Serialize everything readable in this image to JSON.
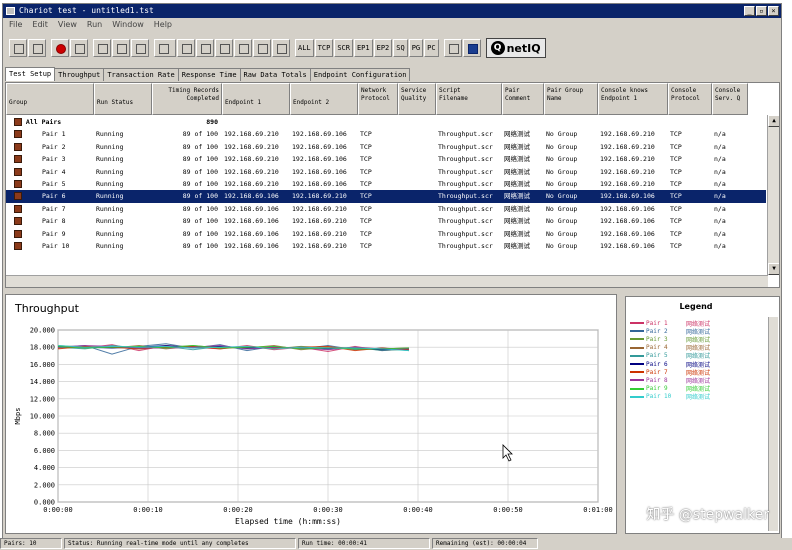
{
  "window": {
    "title": "Chariot test - untitled1.tst",
    "controls": [
      "_",
      "▫",
      "×"
    ]
  },
  "menu": [
    "File",
    "Edit",
    "View",
    "Run",
    "Window",
    "Help"
  ],
  "toolbar": {
    "text_buttons": [
      "ALL",
      "TCP",
      "SCR",
      "EP1",
      "EP2",
      "SQ",
      "PG",
      "PC"
    ],
    "logo": "netIQ"
  },
  "tabs": [
    "Test Setup",
    "Throughput",
    "Transaction Rate",
    "Response Time",
    "Raw Data Totals",
    "Endpoint Configuration"
  ],
  "active_tab": "Test Setup",
  "grid": {
    "headers": [
      "Group",
      "Run Status",
      "Timing Records\nCompleted",
      "Endpoint 1",
      "Endpoint 2",
      "Network\nProtocol",
      "Service\nQuality",
      "Script\nFilename",
      "Pair\nComment",
      "Pair Group\nName",
      "Console knows\nEndpoint 1",
      "Console\nProtocol",
      "Console\nServ. Q"
    ],
    "all_pairs": {
      "label": "All Pairs",
      "records": "890"
    },
    "rows": [
      {
        "pair": "Pair 1",
        "status": "Running",
        "records": "89 of 100",
        "ep1": "192.168.69.210",
        "ep2": "192.168.69.106",
        "proto": "TCP",
        "script": "Throughput.scr",
        "comment": "网络测试",
        "group": "No Group",
        "console_ep1": "192.168.69.210",
        "console_proto": "TCP",
        "servq": "n/a"
      },
      {
        "pair": "Pair 2",
        "status": "Running",
        "records": "89 of 100",
        "ep1": "192.168.69.210",
        "ep2": "192.168.69.106",
        "proto": "TCP",
        "script": "Throughput.scr",
        "comment": "网络测试",
        "group": "No Group",
        "console_ep1": "192.168.69.210",
        "console_proto": "TCP",
        "servq": "n/a"
      },
      {
        "pair": "Pair 3",
        "status": "Running",
        "records": "89 of 100",
        "ep1": "192.168.69.210",
        "ep2": "192.168.69.106",
        "proto": "TCP",
        "script": "Throughput.scr",
        "comment": "网络测试",
        "group": "No Group",
        "console_ep1": "192.168.69.210",
        "console_proto": "TCP",
        "servq": "n/a"
      },
      {
        "pair": "Pair 4",
        "status": "Running",
        "records": "89 of 100",
        "ep1": "192.168.69.210",
        "ep2": "192.168.69.106",
        "proto": "TCP",
        "script": "Throughput.scr",
        "comment": "网络测试",
        "group": "No Group",
        "console_ep1": "192.168.69.210",
        "console_proto": "TCP",
        "servq": "n/a"
      },
      {
        "pair": "Pair 5",
        "status": "Running",
        "records": "89 of 100",
        "ep1": "192.168.69.210",
        "ep2": "192.168.69.106",
        "proto": "TCP",
        "script": "Throughput.scr",
        "comment": "网络测试",
        "group": "No Group",
        "console_ep1": "192.168.69.210",
        "console_proto": "TCP",
        "servq": "n/a"
      },
      {
        "pair": "Pair 6",
        "status": "Running",
        "records": "89 of 100",
        "ep1": "192.168.69.106",
        "ep2": "192.168.69.210",
        "proto": "TCP",
        "script": "Throughput.scr",
        "comment": "网络测试",
        "group": "No Group",
        "console_ep1": "192.168.69.106",
        "console_proto": "TCP",
        "servq": "n/a",
        "selected": true
      },
      {
        "pair": "Pair 7",
        "status": "Running",
        "records": "89 of 100",
        "ep1": "192.168.69.106",
        "ep2": "192.168.69.210",
        "proto": "TCP",
        "script": "Throughput.scr",
        "comment": "网络测试",
        "group": "No Group",
        "console_ep1": "192.168.69.106",
        "console_proto": "TCP",
        "servq": "n/a"
      },
      {
        "pair": "Pair 8",
        "status": "Running",
        "records": "89 of 100",
        "ep1": "192.168.69.106",
        "ep2": "192.168.69.210",
        "proto": "TCP",
        "script": "Throughput.scr",
        "comment": "网络测试",
        "group": "No Group",
        "console_ep1": "192.168.69.106",
        "console_proto": "TCP",
        "servq": "n/a"
      },
      {
        "pair": "Pair 9",
        "status": "Running",
        "records": "89 of 100",
        "ep1": "192.168.69.106",
        "ep2": "192.168.69.210",
        "proto": "TCP",
        "script": "Throughput.scr",
        "comment": "网络测试",
        "group": "No Group",
        "console_ep1": "192.168.69.106",
        "console_proto": "TCP",
        "servq": "n/a"
      },
      {
        "pair": "Pair 10",
        "status": "Running",
        "records": "89 of 100",
        "ep1": "192.168.69.106",
        "ep2": "192.168.69.210",
        "proto": "TCP",
        "script": "Throughput.scr",
        "comment": "网络测试",
        "group": "No Group",
        "console_ep1": "192.168.69.106",
        "console_proto": "TCP",
        "servq": "n/a"
      }
    ]
  },
  "chart_data": {
    "type": "line",
    "title": "Throughput",
    "xlabel": "Elapsed time (h:mm:ss)",
    "ylabel": "Mbps",
    "ylim": [
      0,
      20
    ],
    "yticks": [
      "0.000",
      "2.000",
      "4.000",
      "6.000",
      "8.000",
      "10.000",
      "12.000",
      "14.000",
      "16.000",
      "18.000",
      "20.000"
    ],
    "xticks": [
      "0:00:00",
      "0:00:10",
      "0:00:20",
      "0:00:30",
      "0:00:40",
      "0:00:50",
      "0:01:00"
    ],
    "xlim_seconds": [
      0,
      60
    ],
    "grid": true,
    "series": [
      {
        "name": "Pair 1",
        "color": "#cc3366",
        "x": [
          0,
          3,
          6,
          9,
          12,
          15,
          18,
          21,
          24,
          27,
          30,
          33,
          36,
          39
        ],
        "values": [
          18.1,
          17.9,
          18.3,
          17.6,
          18.2,
          18.0,
          17.8,
          18.2,
          17.7,
          18.0,
          17.5,
          18.1,
          17.6,
          17.8
        ]
      },
      {
        "name": "Pair 2",
        "color": "#336699",
        "x": [
          0,
          3,
          6,
          9,
          12,
          15,
          18,
          21,
          24,
          27,
          30,
          33,
          36,
          39
        ],
        "values": [
          18.0,
          18.2,
          17.2,
          18.1,
          18.4,
          17.9,
          18.3,
          17.6,
          18.1,
          17.8,
          18.2,
          17.7,
          17.9,
          17.6
        ]
      },
      {
        "name": "Pair 3",
        "color": "#669933",
        "x": [
          0,
          3,
          6,
          9,
          12,
          15,
          18,
          21,
          24,
          27,
          30,
          33,
          36,
          39
        ],
        "values": [
          18.2,
          18.0,
          18.1,
          17.8,
          18.0,
          18.2,
          17.9,
          18.0,
          17.8,
          18.1,
          17.9,
          17.8,
          17.7,
          17.7
        ]
      },
      {
        "name": "Pair 4",
        "color": "#996633",
        "x": [
          0,
          3,
          6,
          9,
          12,
          15,
          18,
          21,
          24,
          27,
          30,
          33,
          36,
          39
        ],
        "values": [
          17.9,
          18.1,
          17.9,
          18.2,
          17.8,
          18.1,
          18.0,
          17.9,
          18.2,
          17.7,
          18.0,
          17.9,
          17.8,
          17.9
        ]
      },
      {
        "name": "Pair 5",
        "color": "#339999",
        "x": [
          0,
          3,
          6,
          9,
          12,
          15,
          18,
          21,
          24,
          27,
          30,
          33,
          36,
          39
        ],
        "values": [
          18.0,
          17.8,
          18.2,
          17.9,
          18.1,
          17.7,
          18.1,
          17.8,
          18.0,
          17.9,
          17.8,
          18.0,
          17.6,
          17.8
        ]
      },
      {
        "name": "Pair 6",
        "color": "#000080",
        "x": [
          0,
          3,
          6,
          9,
          12,
          15,
          18,
          21,
          24,
          27,
          30,
          33,
          36,
          39
        ],
        "values": [
          18.1,
          18.0,
          17.9,
          18.0,
          18.2,
          17.9,
          18.1,
          17.9,
          17.9,
          18.0,
          17.8,
          17.9,
          17.7,
          17.8
        ]
      },
      {
        "name": "Pair 7",
        "color": "#cc3300",
        "x": [
          0,
          3,
          6,
          9,
          12,
          15,
          18,
          21,
          24,
          27,
          30,
          33,
          36,
          39
        ],
        "values": [
          17.8,
          18.1,
          18.0,
          17.8,
          18.0,
          18.1,
          17.8,
          18.1,
          17.9,
          18.0,
          18.1,
          17.6,
          17.9,
          17.7
        ]
      },
      {
        "name": "Pair 8",
        "color": "#993399",
        "x": [
          0,
          3,
          6,
          9,
          12,
          15,
          18,
          21,
          24,
          27,
          30,
          33,
          36,
          39
        ],
        "values": [
          18.0,
          18.2,
          18.1,
          17.9,
          17.9,
          18.0,
          18.2,
          17.8,
          18.0,
          17.9,
          17.7,
          18.0,
          17.8,
          17.8
        ]
      },
      {
        "name": "Pair 9",
        "color": "#33cc33",
        "x": [
          0,
          3,
          6,
          9,
          12,
          15,
          18,
          21,
          24,
          27,
          30,
          33,
          36,
          39
        ],
        "values": [
          18.1,
          17.9,
          18.0,
          18.1,
          17.9,
          18.2,
          17.9,
          18.0,
          18.1,
          17.8,
          17.9,
          17.8,
          17.8,
          17.9
        ]
      },
      {
        "name": "Pair 10",
        "color": "#33cccc",
        "x": [
          0,
          3,
          6,
          9,
          12,
          15,
          18,
          21,
          24,
          27,
          30,
          33,
          36,
          39
        ],
        "values": [
          18.2,
          18.0,
          18.1,
          18.0,
          18.1,
          17.9,
          18.0,
          18.1,
          17.8,
          18.0,
          17.9,
          17.9,
          17.8,
          17.6
        ]
      }
    ]
  },
  "legend": {
    "title": "Legend",
    "entries": [
      {
        "name": "Pair 1",
        "comment": "网络测试",
        "color": "#cc3366"
      },
      {
        "name": "Pair 2",
        "comment": "网络测试",
        "color": "#336699"
      },
      {
        "name": "Pair 3",
        "comment": "网络测试",
        "color": "#669933"
      },
      {
        "name": "Pair 4",
        "comment": "网络测试",
        "color": "#996633"
      },
      {
        "name": "Pair 5",
        "comment": "网络测试",
        "color": "#339999"
      },
      {
        "name": "Pair 6",
        "comment": "网络测试",
        "color": "#000080"
      },
      {
        "name": "Pair 7",
        "comment": "网络测试",
        "color": "#cc3300"
      },
      {
        "name": "Pair 8",
        "comment": "网络测试",
        "color": "#993399"
      },
      {
        "name": "Pair 9",
        "comment": "网络测试",
        "color": "#33cc33"
      },
      {
        "name": "Pair 10",
        "comment": "网络测试",
        "color": "#33cccc"
      }
    ]
  },
  "status": {
    "pairs": "Pairs: 10",
    "message": "Status: Running real-time mode until any completes",
    "runtime": "Run time: 00:00:41",
    "remaining": "Remaining (est): 00:00:04"
  },
  "watermark": "知乎 @stepwalker"
}
